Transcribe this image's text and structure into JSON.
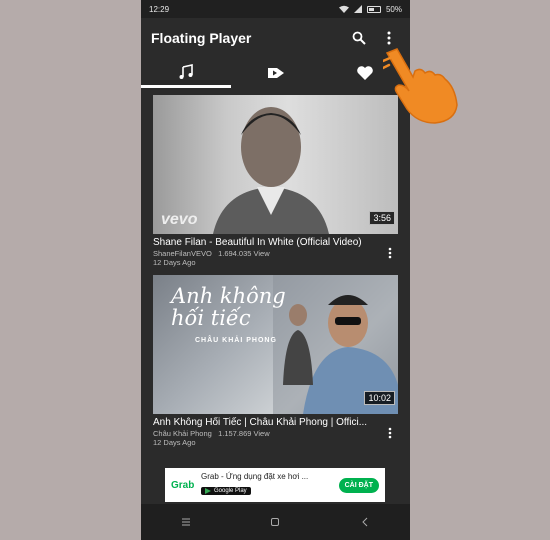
{
  "status": {
    "time": "12:29",
    "battery": "50%"
  },
  "appbar": {
    "title": "Floating Player"
  },
  "tabs": [
    {
      "icon": "music-list-icon",
      "active": true
    },
    {
      "icon": "tag-play-icon",
      "active": false
    },
    {
      "icon": "heart-icon",
      "active": false
    }
  ],
  "videos": [
    {
      "title": "Shane Filan - Beautiful In White (Official Video)",
      "channel": "ShaneFilanVEVO",
      "views": "1.694.035 View",
      "age": "12 Days Ago",
      "duration": "3:56",
      "watermark": "vevo"
    },
    {
      "title": "Anh Không Hối Tiếc | Châu Khải Phong | Offici...",
      "channel": "Châu Khải Phong",
      "views": "1.157.869 View",
      "age": "12 Days Ago",
      "duration": "10:02",
      "thumb_title": "Anh không hối tiếc",
      "thumb_artist": "CHÂU KHẢI PHONG"
    }
  ],
  "ad": {
    "brand": "Grab",
    "title": "Grab - Ứng dụng đặt xe hơi ...",
    "store": "Google Play",
    "cta": "CÀI ĐẶT"
  },
  "colors": {
    "accent": "#00b14f",
    "hand": "#f08a24",
    "background": "#2b2b2b"
  }
}
